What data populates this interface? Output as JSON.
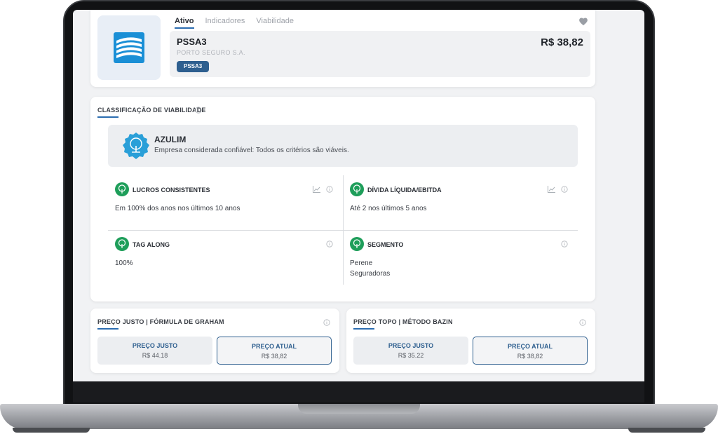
{
  "header": {
    "tabs": [
      {
        "label": "Ativo",
        "active": true
      },
      {
        "label": "Indicadores",
        "active": false
      },
      {
        "label": "Viabilidade",
        "active": false
      }
    ],
    "ticker": "PSSA3",
    "company": "PORTO SEGURO S.A.",
    "badge": "PSSA3",
    "price": "R$ 38,82",
    "favorite_icon": "heart-icon",
    "logo_icon": "porto-seguro-logo"
  },
  "viability": {
    "title": "CLASSIFICAÇÃO DE VIABILIDADE",
    "rating": {
      "name": "AZULIM",
      "description": "Empresa considerada confiável: Todos os critérios são viáveis.",
      "icon": "tree-badge-icon"
    },
    "criteria": [
      {
        "title": "LUCROS CONSISTENTES",
        "value": "Em 100% dos anos nos últimos 10 anos",
        "has_chart": true
      },
      {
        "title": "DÍVIDA LÍQUIDA/EBITDA",
        "value": "Até 2 nos últimos 5 anos",
        "has_chart": true
      },
      {
        "title": "TAG ALONG",
        "value": "100%",
        "has_chart": false
      },
      {
        "title": "SEGMENTO",
        "value": "Perene",
        "value2": "Seguradoras",
        "has_chart": false
      }
    ]
  },
  "graham": {
    "title": "PREÇO JUSTO  | FÓRMULA DE GRAHAM",
    "fair_label": "PREÇO JUSTO",
    "fair_value": "R$ 44.18",
    "current_label": "PREÇO ATUAL",
    "current_value": "R$ 38,82"
  },
  "bazin": {
    "title": "PREÇO TOPO | MÉTODO BAZIN",
    "fair_label": "PREÇO JUSTO",
    "fair_value": "R$ 35.22",
    "current_label": "PREÇO ATUAL",
    "current_value": "R$ 38,82"
  },
  "colors": {
    "accent": "#2b6cb0",
    "badge_bg": "#2e5f8f",
    "criterion_green": "#1e9e5a",
    "azulim_blue": "#2a9fd8"
  }
}
